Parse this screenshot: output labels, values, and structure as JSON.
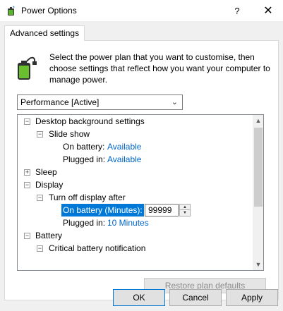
{
  "window": {
    "title": "Power Options",
    "help_glyph": "?",
    "close_glyph": "✕"
  },
  "tab": {
    "label": "Advanced settings"
  },
  "description": "Select the power plan that you want to customise, then choose settings that reflect how you want your computer to manage power.",
  "plan_dropdown": {
    "selected": "Performance [Active]",
    "chevron": "⌄"
  },
  "tree": {
    "expand_glyph": "+",
    "collapse_glyph": "−",
    "items": {
      "desktop_background": "Desktop background settings",
      "slide_show": "Slide show",
      "on_battery_label": "On battery:",
      "slide_battery_value": "Available",
      "plugged_in_label": "Plugged in:",
      "slide_plugged_value": "Available",
      "sleep": "Sleep",
      "display": "Display",
      "turn_off_display": "Turn off display after",
      "on_battery_minutes_label": "On battery (Minutes):",
      "on_battery_minutes_value": "99999",
      "display_plugged_value": "10 Minutes",
      "battery": "Battery",
      "critical_battery": "Critical battery notification"
    }
  },
  "buttons": {
    "restore": "Restore plan defaults",
    "ok": "OK",
    "cancel": "Cancel",
    "apply": "Apply"
  },
  "colors": {
    "accent": "#0078d7",
    "link_value": "#0066cc",
    "dialog_bg": "#f0f0f0"
  },
  "icons": {
    "app": "power-options-icon",
    "battery": "battery-plug-icon"
  }
}
